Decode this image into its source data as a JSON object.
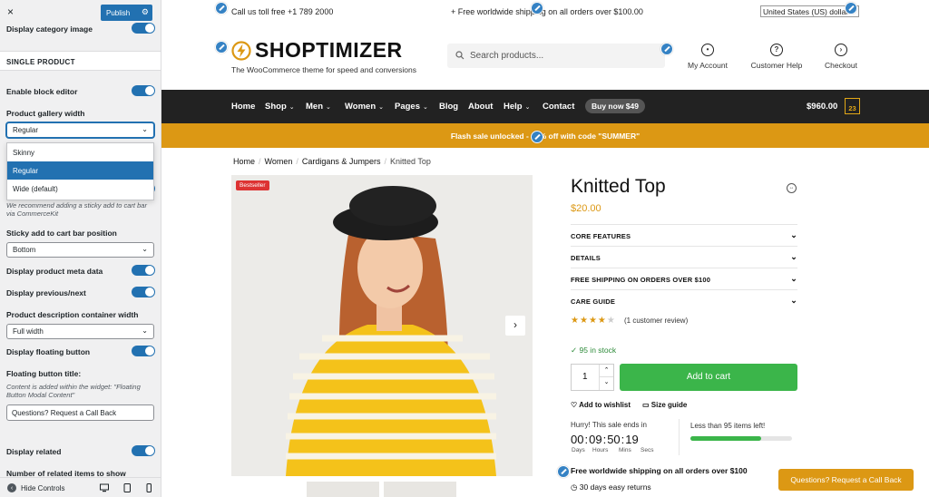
{
  "customizer": {
    "close": "×",
    "publish": "Publish",
    "display_category_image": "Display category image",
    "section_title": "SINGLE PRODUCT",
    "enable_block_editor": "Enable block editor",
    "gallery_width_label": "Product gallery width",
    "gallery_width_value": "Regular",
    "gallery_options": [
      "Skinny",
      "Regular",
      "Wide (default)"
    ],
    "gallery_selected_index": 1,
    "sticky_note": "We recommend adding a sticky add to cart bar via CommerceKit",
    "sticky_position_label": "Sticky add to cart bar position",
    "sticky_position_value": "Bottom",
    "display_meta": "Display product meta data",
    "display_prevnext": "Display previous/next",
    "desc_width_label": "Product description container width",
    "desc_width_value": "Full width",
    "display_floating": "Display floating button",
    "floating_title_label": "Floating button title:",
    "floating_note": "Content is added within the widget: \"Floating Button Modal Content\"",
    "floating_title_value": "Questions? Request a Call Back",
    "display_related": "Display related",
    "related_count_label": "Number of related items to show",
    "hide_controls": "Hide Controls",
    "accent": "#2271b1"
  },
  "site": {
    "topbar": {
      "phone": "Call us toll free +1 789 2000",
      "shipping": "+ Free worldwide shipping on all orders over $100.00",
      "country": "United States (US) dollar"
    },
    "logo": "SHOPTIMIZER",
    "tagline": "The WooCommerce theme for speed and conversions",
    "search_placeholder": "Search products...",
    "header_links": [
      {
        "label": "My Account",
        "icon": "user-icon"
      },
      {
        "label": "Customer Help",
        "icon": "help-icon"
      },
      {
        "label": "Checkout",
        "icon": "arrow-right-icon"
      }
    ],
    "nav": {
      "home": "Home",
      "shop": "Shop",
      "men": "Men",
      "women": "Women",
      "pages": "Pages",
      "blog": "Blog",
      "about": "About",
      "help": "Help",
      "contact": "Contact",
      "buy_now": "Buy now $49",
      "cart_total": "$960.00",
      "cart_count": "23"
    },
    "flash": "Flash sale unlocked - 15% off with code \"SUMMER\"",
    "breadcrumbs": [
      "Home",
      "Women",
      "Cardigans & Jumpers",
      "Knitted Top"
    ],
    "badge": "Bestseller",
    "product": {
      "title": "Knitted Top",
      "price": "$20.00",
      "accordions": [
        "CORE FEATURES",
        "DETAILS",
        "FREE SHIPPING ON ORDERS OVER $100",
        "CARE GUIDE"
      ],
      "rating": 4,
      "rating_max": 5,
      "review_text": "(1 customer review)",
      "stock": "95 in stock",
      "quantity": "1",
      "add_to_cart": "Add to cart",
      "wishlist": "Add to wishlist",
      "size_guide": "Size guide",
      "hurry": "Hurry! This sale ends in",
      "timer": {
        "days": "00",
        "hours": "09",
        "mins": "50",
        "secs": "19"
      },
      "timer_labels": {
        "days": "Days",
        "hours": "Hours",
        "mins": "Mins",
        "secs": "Secs"
      },
      "items_left": "Less than 95 items left!",
      "items_left_fraction": 0.7,
      "free_shipping": "Free worldwide shipping on all orders over $100",
      "returns": "30 days easy returns"
    },
    "floating_button": "Questions? Request a Call Back",
    "colors": {
      "accent": "#dc9814",
      "nav_bg": "#222222",
      "cart_button": "#3bb54a"
    }
  }
}
